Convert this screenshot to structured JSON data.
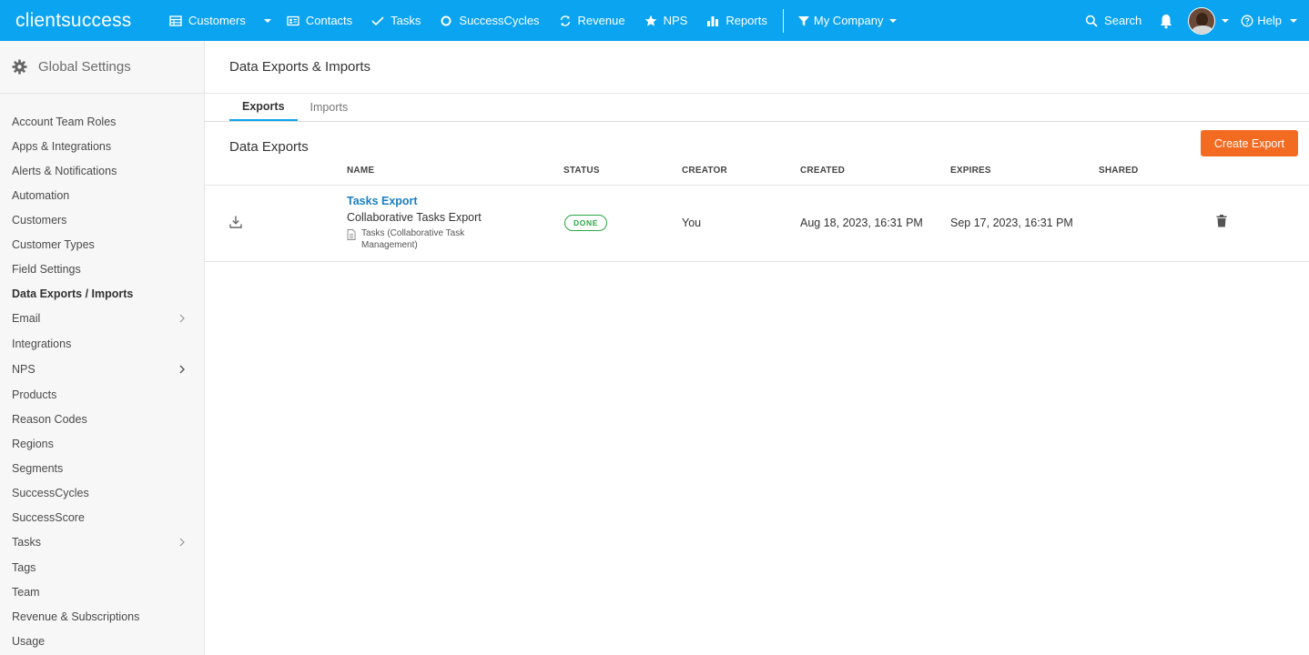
{
  "brand": {
    "logo_light": "client",
    "logo_bold": "success"
  },
  "topnav": {
    "items": [
      {
        "label": "Customers",
        "icon": "table-icon"
      },
      {
        "label": "Contacts",
        "icon": "id-card-icon"
      },
      {
        "label": "Tasks",
        "icon": "checkmark-icon"
      },
      {
        "label": "SuccessCycles",
        "icon": "cycle-icon"
      },
      {
        "label": "Revenue",
        "icon": "refresh-icon"
      },
      {
        "label": "NPS",
        "icon": "star-icon"
      },
      {
        "label": "Reports",
        "icon": "bar-chart-icon"
      }
    ],
    "filter": "My Company",
    "search": "Search",
    "help": "Help"
  },
  "sidebar": {
    "title": "Global Settings",
    "items": [
      {
        "label": "Account Team Roles"
      },
      {
        "label": "Apps & Integrations"
      },
      {
        "label": "Alerts & Notifications"
      },
      {
        "label": "Automation"
      },
      {
        "label": "Customers"
      },
      {
        "label": "Customer Types"
      },
      {
        "label": "Field Settings"
      },
      {
        "label": "Data Exports / Imports",
        "active": true
      },
      {
        "label": "Email",
        "has_children": true
      },
      {
        "label": "Integrations"
      },
      {
        "label": "NPS",
        "has_children": true
      },
      {
        "label": "Products"
      },
      {
        "label": "Reason Codes"
      },
      {
        "label": "Regions"
      },
      {
        "label": "Segments"
      },
      {
        "label": "SuccessCycles"
      },
      {
        "label": "SuccessScore"
      },
      {
        "label": "Tasks",
        "has_children": true
      },
      {
        "label": "Tags"
      },
      {
        "label": "Team"
      },
      {
        "label": "Revenue & Subscriptions"
      },
      {
        "label": "Usage"
      }
    ]
  },
  "main": {
    "title": "Data Exports & Imports",
    "tabs": [
      {
        "label": "Exports",
        "active": true
      },
      {
        "label": "Imports"
      }
    ],
    "section_title": "Data Exports",
    "create_button": "Create Export",
    "columns": [
      "NAME",
      "STATUS",
      "CREATOR",
      "CREATED",
      "EXPIRES",
      "SHARED"
    ],
    "rows": [
      {
        "name": "Tasks Export",
        "description": "Collaborative Tasks Export",
        "file": "Tasks (Collaborative Task Management)",
        "status": "DONE",
        "creator": "You",
        "created": "Aug 18, 2023, 16:31 PM",
        "expires": "Sep 17, 2023, 16:31 PM",
        "shared": ""
      }
    ]
  },
  "colors": {
    "topbar": "#0aa4f0",
    "accent_button": "#f26b21",
    "status_done": "#2aa745",
    "link": "#1b7fc0"
  }
}
